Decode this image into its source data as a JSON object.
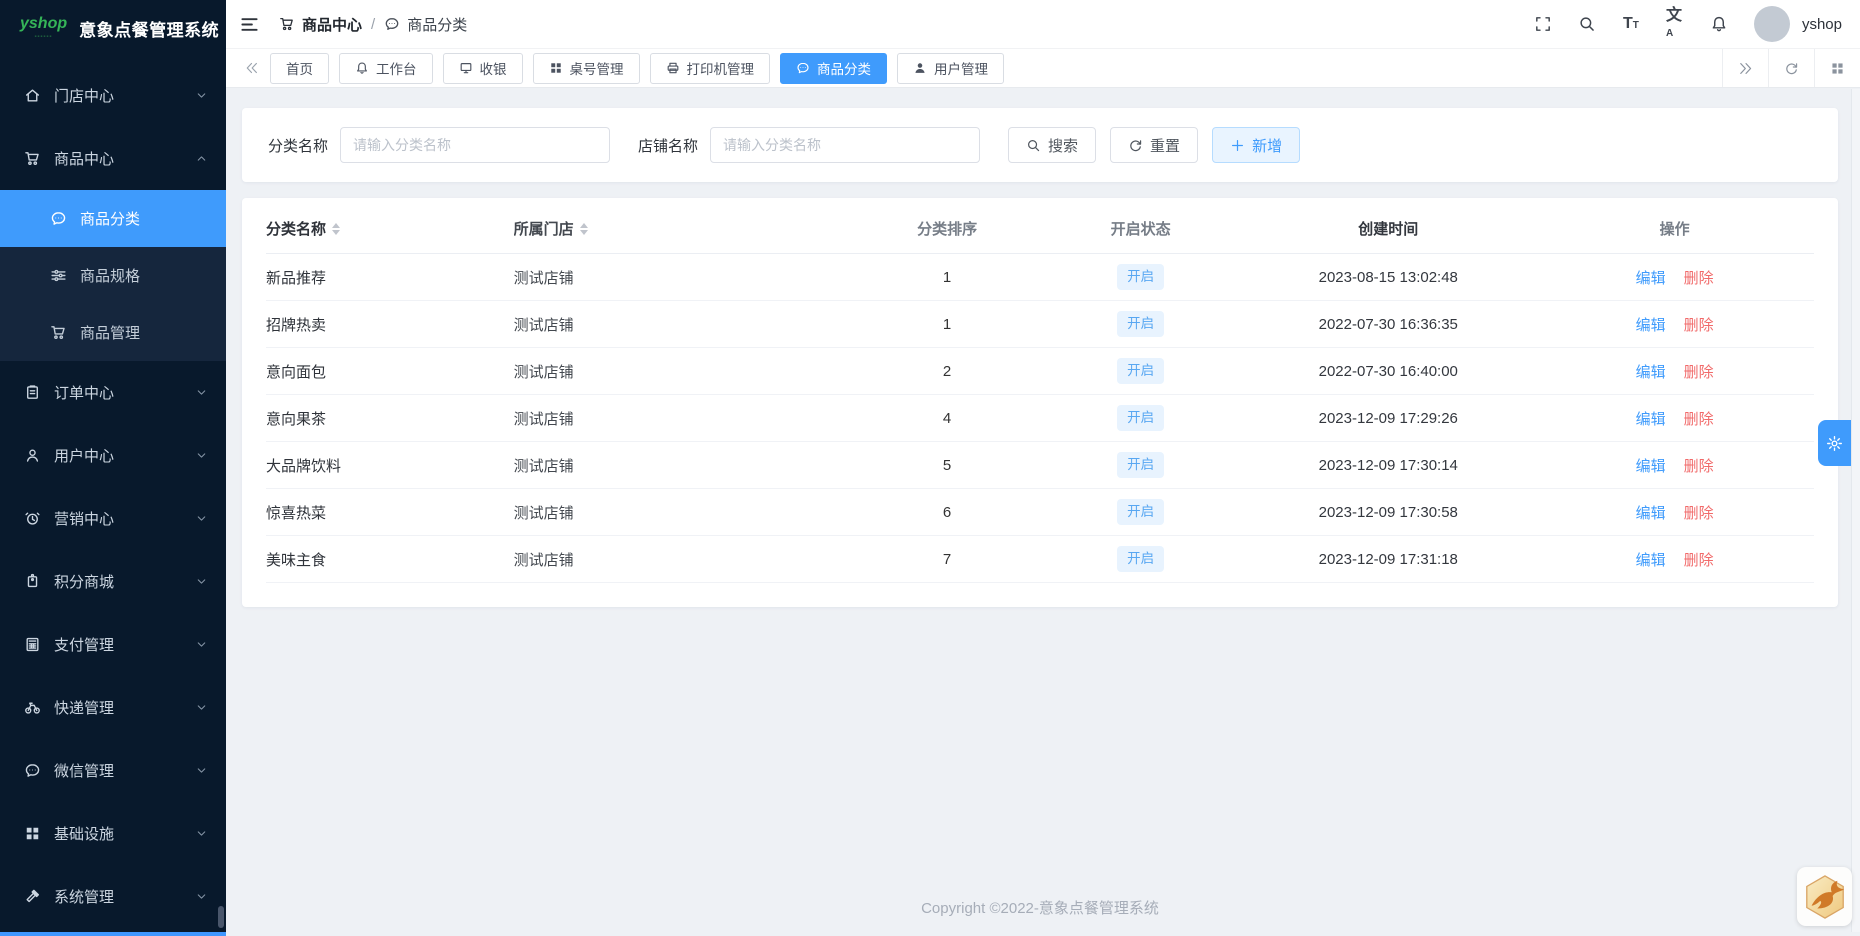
{
  "app": {
    "logo_text": "yshop",
    "title": "意象点餐管理系统",
    "user_name": "yshop"
  },
  "breadcrumb": {
    "parent": "商品中心",
    "parent_icon": "cart",
    "separator": "/",
    "current": "商品分类",
    "current_icon": "chat"
  },
  "header_tools": [
    {
      "icon": "fullscreen"
    },
    {
      "icon": "search"
    },
    {
      "icon": "font-size"
    },
    {
      "icon": "translate"
    },
    {
      "icon": "bell"
    }
  ],
  "sidebar": {
    "items": [
      {
        "icon": "home",
        "label": "门店中心",
        "expanded": false
      },
      {
        "icon": "cart",
        "label": "商品中心",
        "expanded": true,
        "children": [
          {
            "icon": "chat",
            "label": "商品分类",
            "active": true
          },
          {
            "icon": "sliders",
            "label": "商品规格",
            "active": false
          },
          {
            "icon": "cart",
            "label": "商品管理",
            "active": false
          }
        ]
      },
      {
        "icon": "order",
        "label": "订单中心",
        "expanded": false
      },
      {
        "icon": "user",
        "label": "用户中心",
        "expanded": false
      },
      {
        "icon": "clock",
        "label": "营销中心",
        "expanded": false
      },
      {
        "icon": "tag",
        "label": "积分商城",
        "expanded": false
      },
      {
        "icon": "calculator",
        "label": "支付管理",
        "expanded": false
      },
      {
        "icon": "bicycle",
        "label": "快递管理",
        "expanded": false
      },
      {
        "icon": "chat",
        "label": "微信管理",
        "expanded": false
      },
      {
        "icon": "grid",
        "label": "基础设施",
        "expanded": false
      },
      {
        "icon": "hammer",
        "label": "系统管理",
        "expanded": false
      }
    ]
  },
  "tabs": {
    "items": [
      {
        "icon": null,
        "label": "首页",
        "active": false
      },
      {
        "icon": "bell",
        "label": "工作台",
        "active": false
      },
      {
        "icon": "monitor",
        "label": "收银",
        "active": false
      },
      {
        "icon": "grid",
        "label": "桌号管理",
        "active": false
      },
      {
        "icon": "printer",
        "label": "打印机管理",
        "active": false
      },
      {
        "icon": "chat",
        "label": "商品分类",
        "active": true
      },
      {
        "icon": "user-fill",
        "label": "用户管理",
        "active": false
      }
    ],
    "tools": [
      {
        "icon": "double-right"
      },
      {
        "icon": "refresh"
      },
      {
        "icon": "grid"
      }
    ]
  },
  "filter": {
    "category_label": "分类名称",
    "category_placeholder": "请输入分类名称",
    "category_value": "",
    "store_label": "店铺名称",
    "store_placeholder": "请输入分类名称",
    "store_value": "",
    "search_label": "搜索",
    "reset_label": "重置",
    "add_label": "新增"
  },
  "table": {
    "columns": [
      {
        "label": "分类名称",
        "sortable": true
      },
      {
        "label": "所属门店",
        "sortable": true
      },
      {
        "label": "分类排序",
        "sortable": false
      },
      {
        "label": "开启状态",
        "sortable": false
      },
      {
        "label": "创建时间",
        "sortable": false
      },
      {
        "label": "操作",
        "sortable": false
      }
    ],
    "rows": [
      {
        "name": "新品推荐",
        "store": "测试店铺",
        "sort": "1",
        "status": "开启",
        "created": "2023-08-15 13:02:48"
      },
      {
        "name": "招牌热卖",
        "store": "测试店铺",
        "sort": "1",
        "status": "开启",
        "created": "2022-07-30 16:36:35"
      },
      {
        "name": "意向面包",
        "store": "测试店铺",
        "sort": "2",
        "status": "开启",
        "created": "2022-07-30 16:40:00"
      },
      {
        "name": "意向果茶",
        "store": "测试店铺",
        "sort": "4",
        "status": "开启",
        "created": "2023-12-09 17:29:26"
      },
      {
        "name": "大品牌饮料",
        "store": "测试店铺",
        "sort": "5",
        "status": "开启",
        "created": "2023-12-09 17:30:14"
      },
      {
        "name": "惊喜热菜",
        "store": "测试店铺",
        "sort": "6",
        "status": "开启",
        "created": "2023-12-09 17:30:58"
      },
      {
        "name": "美味主食",
        "store": "测试店铺",
        "sort": "7",
        "status": "开启",
        "created": "2023-12-09 17:31:18"
      }
    ],
    "edit_label": "编辑",
    "delete_label": "删除"
  },
  "footer": {
    "copyright": "Copyright ©2022-意象点餐管理系统"
  },
  "colors": {
    "accent": "#3f9bfc",
    "danger": "#f16a6a",
    "sidebar_bg": "#08192c",
    "submenu_bg": "#15263d",
    "badge_bg": "#e8f3fe",
    "badge_text": "#58a7f2"
  }
}
